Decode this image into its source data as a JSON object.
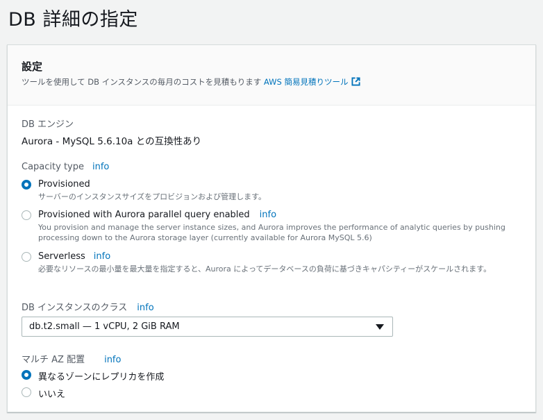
{
  "page": {
    "title": "DB 詳細の指定"
  },
  "panel": {
    "title": "設定",
    "description": "ツールを使用して DB インスタンスの毎月のコストを見積もります",
    "link_label": "AWS 簡易見積りツール"
  },
  "engine": {
    "label": "DB エンジン",
    "value": "Aurora - MySQL 5.6.10a との互換性あり"
  },
  "capacity": {
    "label": "Capacity type",
    "info": "info",
    "options": [
      {
        "label": "Provisioned",
        "info": "",
        "desc": "サーバーのインスタンスサイズをプロビジョンおよび管理します。",
        "checked": true
      },
      {
        "label": "Provisioned with Aurora parallel query enabled",
        "info": "info",
        "desc": "You provision and manage the server instance sizes, and Aurora improves the performance of analytic queries by pushing processing down to the Aurora storage layer (currently available for Aurora MySQL 5.6)",
        "checked": false
      },
      {
        "label": "Serverless",
        "info": "info",
        "desc": "必要なリソースの最小量を最大量を指定すると、Aurora によってデータベースの負荷に基づきキャパシティーがスケールされます。",
        "checked": false
      }
    ]
  },
  "instance_class": {
    "label": "DB インスタンスのクラス",
    "info": "info",
    "selected": "db.t2.small — 1 vCPU, 2 GiB RAM"
  },
  "multi_az": {
    "label": "マルチ AZ 配置",
    "info": "info",
    "options": [
      {
        "label": "異なるゾーンにレプリカを作成",
        "checked": true
      },
      {
        "label": "いいえ",
        "checked": false
      }
    ]
  },
  "colors": {
    "accent": "#0073bb",
    "text": "#16191f",
    "muted": "#545b64"
  }
}
